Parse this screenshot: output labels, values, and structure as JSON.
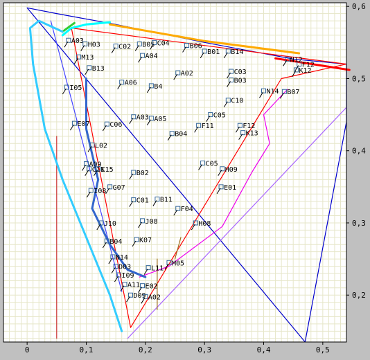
{
  "chart_data": {
    "type": "scatter",
    "title": "",
    "xlabel": "",
    "ylabel": "",
    "xlim": [
      -0.04,
      0.54
    ],
    "ylim": [
      0.135,
      0.605
    ],
    "grid": true,
    "x_ticks": [
      {
        "value": 0,
        "label": "0"
      },
      {
        "value": 0.1,
        "label": "0,1"
      },
      {
        "value": 0.2,
        "label": "0,2"
      },
      {
        "value": 0.3,
        "label": "0,3"
      },
      {
        "value": 0.4,
        "label": "0,4"
      },
      {
        "value": 0.5,
        "label": "0,5"
      }
    ],
    "y_ticks": [
      {
        "value": 0.2,
        "label": "0,2"
      },
      {
        "value": 0.3,
        "label": "0,3"
      },
      {
        "value": 0.4,
        "label": "0,4"
      },
      {
        "value": 0.5,
        "label": "0,5"
      },
      {
        "value": 0.6,
        "label": "0,6"
      }
    ],
    "colors": {
      "background": "#c0c0c0",
      "plot_bg": "#ffffff",
      "grid": "#e6e6c8",
      "spectral_locus": "#0000cc",
      "gamut_red": "#ff0000",
      "gamut_magenta": "#ee00ee",
      "gamut_purple": "#aa66ff",
      "axis": "#000000"
    },
    "curves": [
      {
        "name": "locus",
        "color": "#0000cc",
        "points": [
          [
            0,
            0.598
          ],
          [
            0.05,
            0.59
          ],
          [
            0.15,
            0.575
          ],
          [
            0.3,
            0.55
          ],
          [
            0.45,
            0.527
          ],
          [
            0.54,
            0.52
          ],
          [
            0.54,
            0.44
          ],
          [
            0.47,
            0.135
          ],
          [
            0,
            0.598
          ]
        ]
      },
      {
        "name": "blue-dashed-line",
        "color": "#4444ff",
        "points": [
          [
            0.04,
            0.58
          ],
          [
            0.16,
            0.205
          ]
        ]
      },
      {
        "name": "purple-line",
        "color": "#aa66ff",
        "points": [
          [
            0.17,
            0.14
          ],
          [
            0.54,
            0.46
          ]
        ]
      },
      {
        "name": "red-vertical",
        "color": "#cc3333",
        "points": [
          [
            0.05,
            0.42
          ],
          [
            0.05,
            0.14
          ]
        ]
      },
      {
        "name": "red-gamut",
        "color": "#ff0000",
        "points": [
          [
            0.075,
            0.57
          ],
          [
            0.54,
            0.52
          ],
          [
            0.43,
            0.5
          ],
          [
            0.175,
            0.155
          ],
          [
            0.075,
            0.57
          ]
        ]
      },
      {
        "name": "magenta-gamut",
        "color": "#ee00ee",
        "points": [
          [
            0.19,
            0.225
          ],
          [
            0.24,
            0.24
          ],
          [
            0.33,
            0.295
          ],
          [
            0.38,
            0.37
          ],
          [
            0.41,
            0.41
          ],
          [
            0.4,
            0.45
          ],
          [
            0.44,
            0.485
          ]
        ]
      },
      {
        "name": "orange-yellow-band",
        "color": "#ffaa00",
        "points": [
          [
            0.14,
            0.575
          ],
          [
            0.3,
            0.552
          ],
          [
            0.46,
            0.535
          ]
        ]
      },
      {
        "name": "red-band",
        "color": "#ff0000",
        "points": [
          [
            0.42,
            0.528
          ],
          [
            0.545,
            0.512
          ]
        ]
      },
      {
        "name": "cyan-band",
        "color": "#00ffff",
        "points": [
          [
            0.06,
            0.56
          ],
          [
            0.075,
            0.57
          ],
          [
            0.1,
            0.575
          ],
          [
            0.14,
            0.578
          ]
        ]
      },
      {
        "name": "green-band",
        "color": "#33cc33",
        "points": [
          [
            0.06,
            0.565
          ],
          [
            0.08,
            0.577
          ]
        ]
      },
      {
        "name": "cyan-locus",
        "color": "#33ccff",
        "points": [
          [
            0.06,
            0.565
          ],
          [
            0.02,
            0.58
          ],
          [
            0.005,
            0.57
          ],
          [
            0.01,
            0.52
          ],
          [
            0.03,
            0.43
          ],
          [
            0.06,
            0.36
          ],
          [
            0.1,
            0.28
          ],
          [
            0.14,
            0.2
          ],
          [
            0.16,
            0.15
          ]
        ]
      },
      {
        "name": "blue-locus",
        "color": "#3366cc",
        "points": [
          [
            0.1,
            0.5
          ],
          [
            0.1,
            0.43
          ],
          [
            0.12,
            0.36
          ],
          [
            0.11,
            0.32
          ],
          [
            0.14,
            0.27
          ],
          [
            0.17,
            0.235
          ],
          [
            0.2,
            0.225
          ]
        ]
      },
      {
        "name": "brown-vline",
        "color": "#a07020",
        "points": [
          [
            0.22,
            0.18
          ],
          [
            0.22,
            0.25
          ]
        ]
      },
      {
        "name": "brown-vline-2",
        "color": "#a07020",
        "points": [
          [
            0.25,
            0.25
          ],
          [
            0.26,
            0.28
          ]
        ]
      }
    ],
    "points": [
      {
        "label": "A03",
        "x": 0.07,
        "y": 0.553
      },
      {
        "label": "H03",
        "x": 0.098,
        "y": 0.548
      },
      {
        "label": "M13",
        "x": 0.087,
        "y": 0.53
      },
      {
        "label": "B13",
        "x": 0.105,
        "y": 0.515
      },
      {
        "label": "I05",
        "x": 0.067,
        "y": 0.488
      },
      {
        "label": "E07",
        "x": 0.08,
        "y": 0.438
      },
      {
        "label": "C06",
        "x": 0.135,
        "y": 0.437
      },
      {
        "label": "L02",
        "x": 0.11,
        "y": 0.408
      },
      {
        "label": "A09",
        "x": 0.1,
        "y": 0.382
      },
      {
        "label": "C11",
        "x": 0.105,
        "y": 0.375
      },
      {
        "label": "K15",
        "x": 0.12,
        "y": 0.375
      },
      {
        "label": "G07",
        "x": 0.14,
        "y": 0.35
      },
      {
        "label": "I08",
        "x": 0.108,
        "y": 0.345
      },
      {
        "label": "C01",
        "x": 0.18,
        "y": 0.332
      },
      {
        "label": "B11",
        "x": 0.22,
        "y": 0.333
      },
      {
        "label": "J10",
        "x": 0.125,
        "y": 0.3
      },
      {
        "label": "J08",
        "x": 0.195,
        "y": 0.303
      },
      {
        "label": "B04",
        "x": 0.135,
        "y": 0.275
      },
      {
        "label": "K07",
        "x": 0.185,
        "y": 0.277
      },
      {
        "label": "N14",
        "x": 0.145,
        "y": 0.253
      },
      {
        "label": "D03",
        "x": 0.15,
        "y": 0.24
      },
      {
        "label": "I09",
        "x": 0.155,
        "y": 0.228
      },
      {
        "label": "A11",
        "x": 0.165,
        "y": 0.215
      },
      {
        "label": "D09",
        "x": 0.175,
        "y": 0.2
      },
      {
        "label": "A02",
        "x": 0.2,
        "y": 0.198
      },
      {
        "label": "E02",
        "x": 0.195,
        "y": 0.213
      },
      {
        "label": "L11",
        "x": 0.205,
        "y": 0.238
      },
      {
        "label": "M05",
        "x": 0.24,
        "y": 0.245
      },
      {
        "label": "C02",
        "x": 0.15,
        "y": 0.545
      },
      {
        "label": "B05",
        "x": 0.19,
        "y": 0.548
      },
      {
        "label": "C04",
        "x": 0.215,
        "y": 0.55
      },
      {
        "label": "B06",
        "x": 0.27,
        "y": 0.546
      },
      {
        "label": "A04",
        "x": 0.195,
        "y": 0.532
      },
      {
        "label": "B01",
        "x": 0.3,
        "y": 0.538
      },
      {
        "label": "B14",
        "x": 0.34,
        "y": 0.538
      },
      {
        "label": "C03",
        "x": 0.345,
        "y": 0.51
      },
      {
        "label": "A02",
        "x": 0.255,
        "y": 0.508
      },
      {
        "label": "B03",
        "x": 0.345,
        "y": 0.498
      },
      {
        "label": "A06",
        "x": 0.16,
        "y": 0.495
      },
      {
        "label": "B4",
        "x": 0.21,
        "y": 0.49
      },
      {
        "label": "C10",
        "x": 0.34,
        "y": 0.47
      },
      {
        "label": "C05",
        "x": 0.31,
        "y": 0.45
      },
      {
        "label": "F11",
        "x": 0.29,
        "y": 0.435
      },
      {
        "label": "A03",
        "x": 0.18,
        "y": 0.447
      },
      {
        "label": "A05",
        "x": 0.21,
        "y": 0.445
      },
      {
        "label": "B04",
        "x": 0.245,
        "y": 0.424
      },
      {
        "label": "F12",
        "x": 0.36,
        "y": 0.435
      },
      {
        "label": "K13",
        "x": 0.365,
        "y": 0.425
      },
      {
        "label": "N14",
        "x": 0.4,
        "y": 0.483
      },
      {
        "label": "B07",
        "x": 0.435,
        "y": 0.482
      },
      {
        "label": "B02",
        "x": 0.18,
        "y": 0.37
      },
      {
        "label": "C05",
        "x": 0.297,
        "y": 0.383
      },
      {
        "label": "H09",
        "x": 0.33,
        "y": 0.375
      },
      {
        "label": "E01",
        "x": 0.328,
        "y": 0.35
      },
      {
        "label": "F04",
        "x": 0.255,
        "y": 0.32
      },
      {
        "label": "H08",
        "x": 0.285,
        "y": 0.3
      },
      {
        "label": "K12",
        "x": 0.455,
        "y": 0.512
      },
      {
        "label": "N12",
        "x": 0.44,
        "y": 0.527
      },
      {
        "label": "F12",
        "x": 0.46,
        "y": 0.52
      }
    ]
  }
}
